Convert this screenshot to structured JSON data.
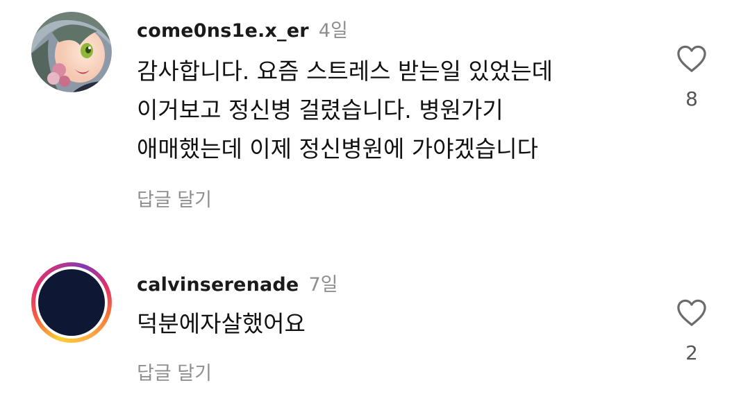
{
  "comments": [
    {
      "username": "come0ns1e.x_er",
      "time": "4일",
      "lines": [
        "감사합니다. 요즘 스트레스 받는일 있었는데",
        "이거보고 정신병 걸렸습니다. 병원가기",
        "애매했는데 이제 정신병원에 가야겠습니다"
      ],
      "reply_label": "답글 달기",
      "like_count": "8",
      "avatar": "anime-character-avatar"
    },
    {
      "username": "calvinserenade",
      "time": "7일",
      "lines": [
        "덕분에자살했어요"
      ],
      "reply_label": "답글 달기",
      "like_count": "2",
      "avatar": "navy-circle-avatar-with-story-ring"
    }
  ],
  "icons": {
    "like": "heart-outline-icon"
  },
  "colors": {
    "username": "#1a1a1a",
    "secondary_text": "#8e8e8e",
    "body_text": "#111111",
    "avatar_fill": "#0e1733",
    "story_ring": [
      "#f9ce34",
      "#ee2a7b",
      "#6228d7"
    ]
  }
}
